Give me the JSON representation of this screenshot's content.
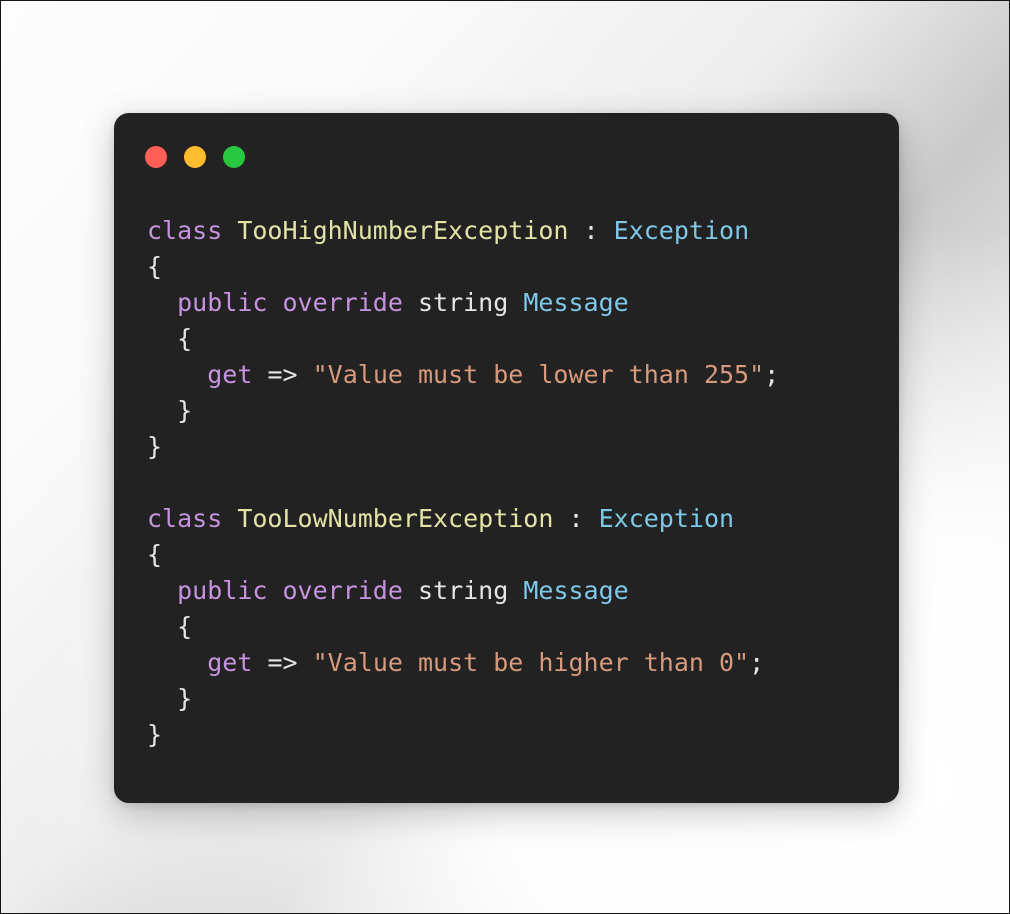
{
  "window": {
    "background_color": "#222222",
    "controls": [
      {
        "name": "close",
        "color": "#ff5f57",
        "label": ""
      },
      {
        "name": "minimize",
        "color": "#febc2e",
        "label": ""
      },
      {
        "name": "maximize",
        "color": "#28c840",
        "label": ""
      }
    ]
  },
  "theme": {
    "page_background": "#f2f2f2",
    "keyword": "#c792df",
    "type_name": "#e3e3a6",
    "base_class": "#7fc8e8",
    "string": "#d79a7d",
    "plain": "#e6e6e6"
  },
  "code": {
    "language": "csharp",
    "plain_text": "class TooHighNumberException : Exception\n{\n  public override string Message\n  {\n    get => \"Value must be lower than 255\";\n  }\n}\n\nclass TooLowNumberException : Exception\n{\n  public override string Message\n  {\n    get => \"Value must be higher than 0\";\n  }\n}",
    "lines": [
      {
        "indent": 0,
        "tokens": [
          {
            "t": "class",
            "c": "kw"
          },
          {
            "t": " ",
            "c": "plain"
          },
          {
            "t": "TooHighNumberException",
            "c": "type"
          },
          {
            "t": " ",
            "c": "plain"
          },
          {
            "t": ":",
            "c": "punct"
          },
          {
            "t": " ",
            "c": "plain"
          },
          {
            "t": "Exception",
            "c": "class"
          }
        ]
      },
      {
        "indent": 0,
        "tokens": [
          {
            "t": "{",
            "c": "punct"
          }
        ]
      },
      {
        "indent": 0,
        "tokens": [
          {
            "t": "  ",
            "c": "plain"
          },
          {
            "t": "public",
            "c": "kw"
          },
          {
            "t": " ",
            "c": "plain"
          },
          {
            "t": "override",
            "c": "kw"
          },
          {
            "t": " ",
            "c": "plain"
          },
          {
            "t": "string",
            "c": "plain"
          },
          {
            "t": " ",
            "c": "plain"
          },
          {
            "t": "Message",
            "c": "class"
          }
        ]
      },
      {
        "indent": 0,
        "tokens": [
          {
            "t": "  {",
            "c": "punct"
          }
        ]
      },
      {
        "indent": 0,
        "tokens": [
          {
            "t": "    ",
            "c": "plain"
          },
          {
            "t": "get",
            "c": "kw"
          },
          {
            "t": " ",
            "c": "plain"
          },
          {
            "t": "=>",
            "c": "op"
          },
          {
            "t": " ",
            "c": "plain"
          },
          {
            "t": "\"Value must be lower than 255\"",
            "c": "str"
          },
          {
            "t": ";",
            "c": "punct"
          }
        ]
      },
      {
        "indent": 0,
        "tokens": [
          {
            "t": "  }",
            "c": "punct"
          }
        ]
      },
      {
        "indent": 0,
        "tokens": [
          {
            "t": "}",
            "c": "punct"
          }
        ]
      },
      {
        "indent": 0,
        "tokens": []
      },
      {
        "indent": 0,
        "tokens": [
          {
            "t": "class",
            "c": "kw"
          },
          {
            "t": " ",
            "c": "plain"
          },
          {
            "t": "TooLowNumberException",
            "c": "type"
          },
          {
            "t": " ",
            "c": "plain"
          },
          {
            "t": ":",
            "c": "punct"
          },
          {
            "t": " ",
            "c": "plain"
          },
          {
            "t": "Exception",
            "c": "class"
          }
        ]
      },
      {
        "indent": 0,
        "tokens": [
          {
            "t": "{",
            "c": "punct"
          }
        ]
      },
      {
        "indent": 0,
        "tokens": [
          {
            "t": "  ",
            "c": "plain"
          },
          {
            "t": "public",
            "c": "kw"
          },
          {
            "t": " ",
            "c": "plain"
          },
          {
            "t": "override",
            "c": "kw"
          },
          {
            "t": " ",
            "c": "plain"
          },
          {
            "t": "string",
            "c": "plain"
          },
          {
            "t": " ",
            "c": "plain"
          },
          {
            "t": "Message",
            "c": "class"
          }
        ]
      },
      {
        "indent": 0,
        "tokens": [
          {
            "t": "  {",
            "c": "punct"
          }
        ]
      },
      {
        "indent": 0,
        "tokens": [
          {
            "t": "    ",
            "c": "plain"
          },
          {
            "t": "get",
            "c": "kw"
          },
          {
            "t": " ",
            "c": "plain"
          },
          {
            "t": "=>",
            "c": "op"
          },
          {
            "t": " ",
            "c": "plain"
          },
          {
            "t": "\"Value must be higher than 0\"",
            "c": "str"
          },
          {
            "t": ";",
            "c": "punct"
          }
        ]
      },
      {
        "indent": 0,
        "tokens": [
          {
            "t": "  }",
            "c": "punct"
          }
        ]
      },
      {
        "indent": 0,
        "tokens": [
          {
            "t": "}",
            "c": "punct"
          }
        ]
      }
    ]
  }
}
